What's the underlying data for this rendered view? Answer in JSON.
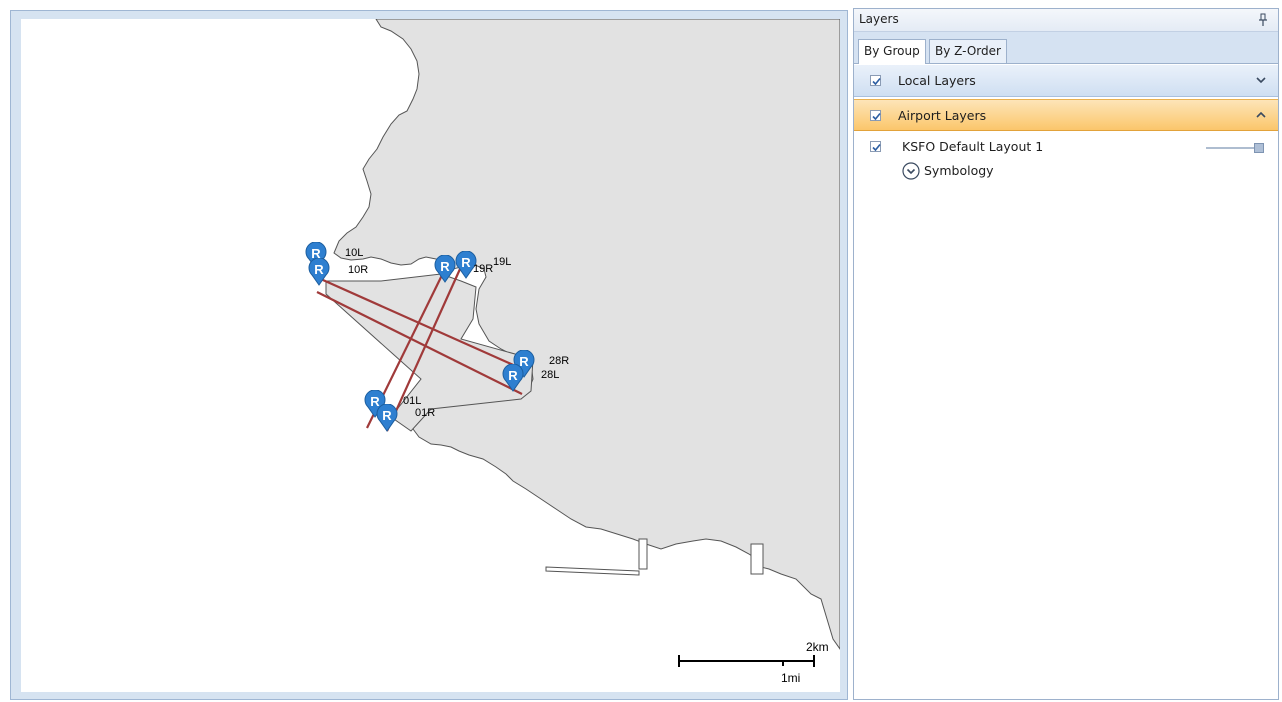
{
  "map": {
    "runway_labels": [
      "10L",
      "10R",
      "19R",
      "19L",
      "28R",
      "28L",
      "01L",
      "01R"
    ],
    "pin_letter": "R",
    "scale_km": "2km",
    "scale_mi": "1mi",
    "colors": {
      "land": "#e2e2e2",
      "water": "#ffffff",
      "runway": "#a03a3a",
      "pin": "#2e7fd0",
      "frame": "#d6e3f1"
    }
  },
  "panel": {
    "title": "Layers",
    "pin_icon": "pushpin-icon",
    "tabs": [
      {
        "label": "By Group",
        "selected": true
      },
      {
        "label": "By Z-Order",
        "selected": false
      }
    ],
    "groups": [
      {
        "label": "Local Layers",
        "checked": true,
        "expanded": false,
        "icon": "chevron-down-icon"
      },
      {
        "label": "Airport Layers",
        "checked": true,
        "expanded": true,
        "icon": "chevron-up-icon"
      }
    ],
    "layers": [
      {
        "name": "KSFO Default Layout 1",
        "checked": true,
        "opacity": 1.0
      }
    ],
    "symbology": {
      "label": "Symbology",
      "icon": "expand-circle-icon"
    },
    "colors": {
      "group_header": "#cfdff2",
      "active_group_header": "#fbc66b"
    }
  }
}
